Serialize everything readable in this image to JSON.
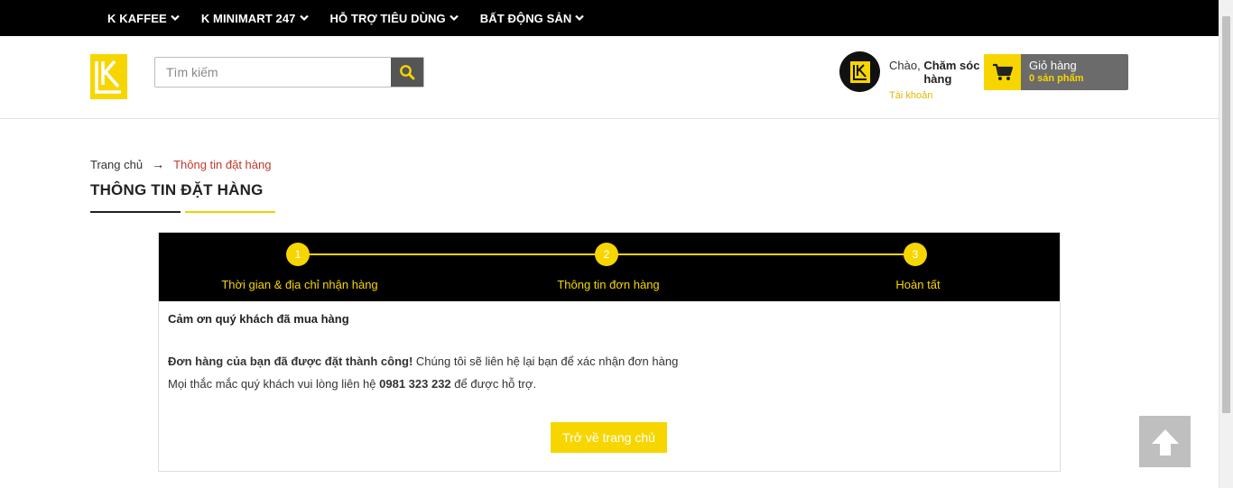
{
  "topnav": {
    "items": [
      {
        "label": "K KAFFEE"
      },
      {
        "label": "K MINIMART 247"
      },
      {
        "label": "HỖ TRỢ TIÊU DÙNG"
      },
      {
        "label": "BẤT ĐỘNG SẢN"
      }
    ]
  },
  "search": {
    "placeholder": "Tìm kiếm",
    "value": ""
  },
  "account": {
    "greeting": "Chào,",
    "name": "Chăm sóc khách hàng",
    "link": "Tài khoản"
  },
  "cart": {
    "label": "Giỏ hàng",
    "count": "0 sản phẩm"
  },
  "breadcrumb": {
    "home": "Trang chủ",
    "separator": "→",
    "current": "Thông tin đặt hàng"
  },
  "page": {
    "title": "THÔNG TIN ĐẶT HÀNG"
  },
  "steps": [
    {
      "number": "1",
      "label": "Thời gian & địa chỉ nhận hàng"
    },
    {
      "number": "2",
      "label": "Thông tin đơn hàng"
    },
    {
      "number": "3",
      "label": "Hoàn tất"
    }
  ],
  "content": {
    "thanks": "Cảm ơn quý khách đã mua hàng",
    "success_bold": "Đơn hàng của bạn đã được đặt thành công!",
    "success_rest": " Chúng tôi sẽ liên hệ lại bạn để xác nhận đơn hàng",
    "support_prefix": "Mọi thắc mắc quý khách vui lòng liên hệ ",
    "support_phone": "0981 323 232",
    "support_suffix": " để được hỗ trợ."
  },
  "buttons": {
    "home": "Trở về trang chủ"
  },
  "colors": {
    "accent": "#f7d600",
    "dark": "#000000",
    "breadcrumb_current": "#c0392b"
  },
  "icons": {
    "search": "search-icon",
    "cart": "cart-icon",
    "chevron": "chevron-down-icon",
    "back_to_top": "arrow-up-icon"
  }
}
